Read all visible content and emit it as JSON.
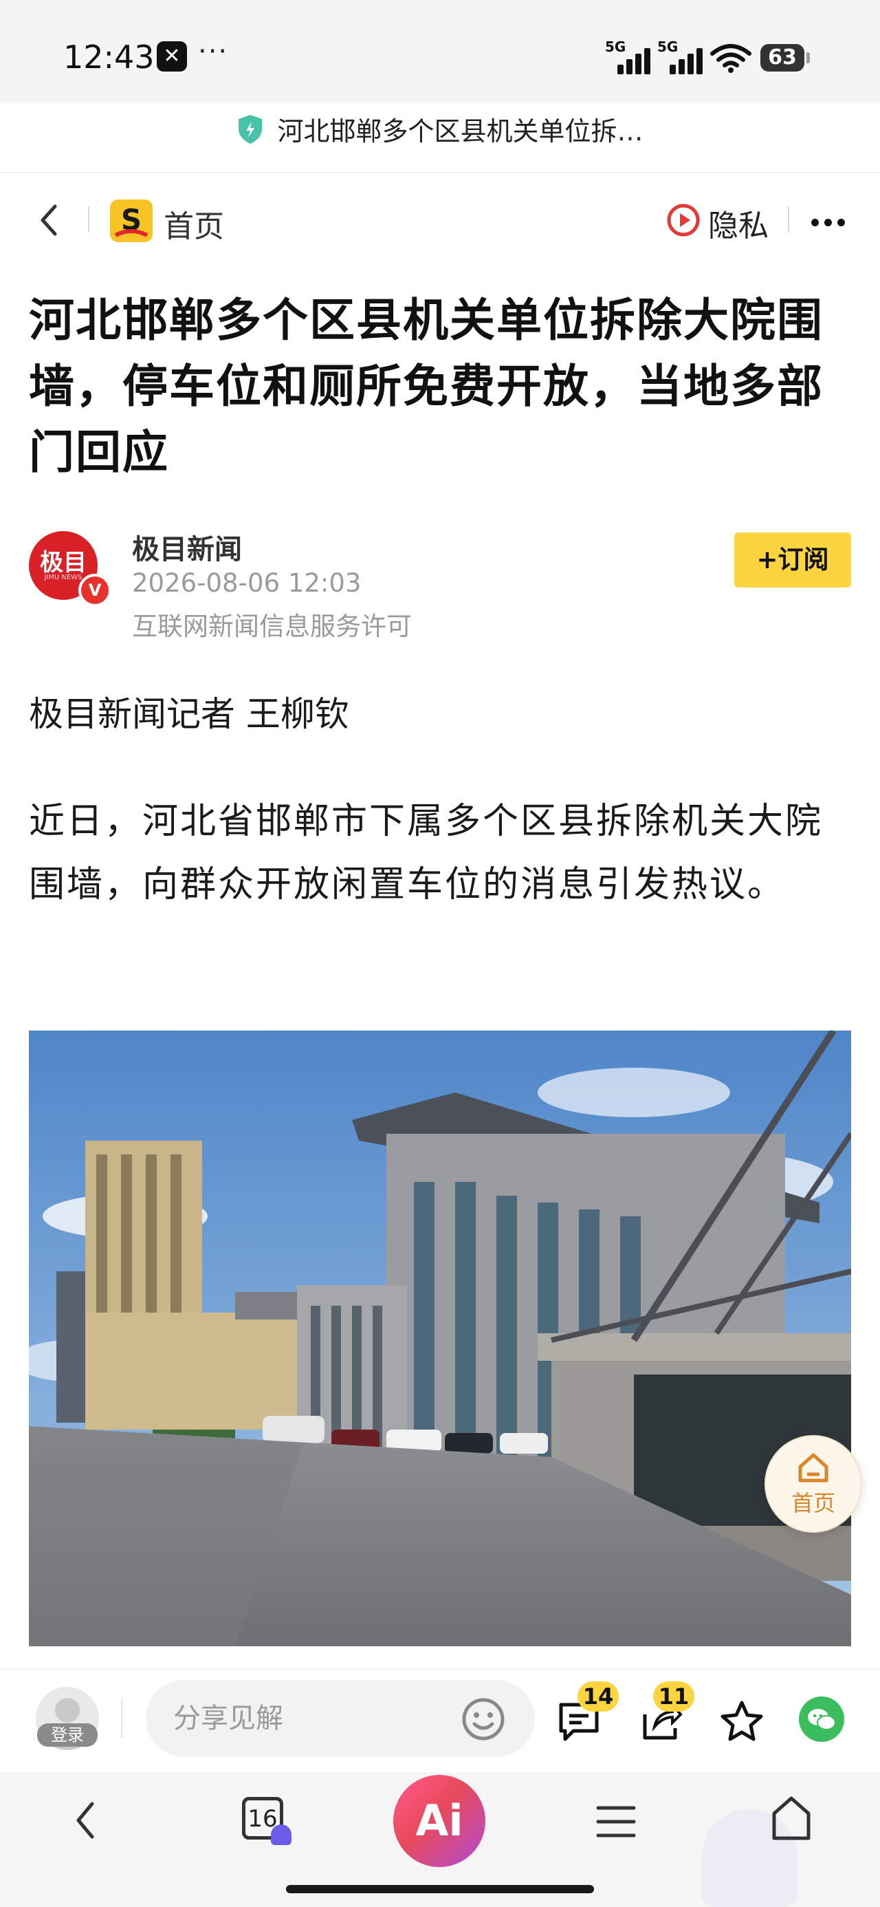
{
  "status_bar": {
    "time": "12:43",
    "network_1": "5G",
    "network_2": "5G",
    "battery": "63",
    "icons": [
      "capcut-icon",
      "more-dots-icon",
      "signal-icon",
      "wifi-icon",
      "battery-icon"
    ]
  },
  "url_bar": {
    "title": "河北邯郸多个区县机关单位拆…",
    "icon": "shield-check-icon"
  },
  "nav": {
    "home_label": "首页",
    "privacy_label": "隐私",
    "icons": [
      "back-icon",
      "sohu-logo-icon",
      "privacy-icon",
      "more-icon"
    ]
  },
  "article": {
    "headline": "河北邯郸多个区县机关单位拆除大院围墙，停车位和厕所免费开放，当地多部门回应",
    "author": {
      "avatar_text": "极目",
      "avatar_subtext": "JIMU NEWS",
      "verified_mark": "V",
      "name": "极目新闻",
      "published": "2026-08-06 12:03",
      "license": "互联网新闻信息服务许可",
      "subscribe_label": "+订阅"
    },
    "reporter_line": "极目新闻记者 王柳钦",
    "paragraph_1": "近日，河北省邯郸市下属多个区县拆除机关大院围墙，向群众开放闲置车位的消息引发热议。",
    "image_description": "government-building-courtyard-photo"
  },
  "float_home": {
    "label": "首页",
    "icon": "house-icon"
  },
  "comment_bar": {
    "login_label": "登录",
    "input_placeholder": "分享见解",
    "comment_count": "14",
    "share_count": "11",
    "icons": [
      "emoji-icon",
      "comments-icon",
      "share-icon",
      "star-icon",
      "wechat-icon"
    ]
  },
  "browser_nav": {
    "tab_count": "16",
    "ai_label": "Ai",
    "icons": [
      "nav-back-icon",
      "tabs-icon",
      "ai-icon",
      "menu-icon",
      "home-icon"
    ]
  },
  "colors": {
    "accent_yellow": "#fbd53f",
    "brand_red": "#d92026",
    "float_home_text": "#d8872c",
    "wechat_green": "#3bbd5d"
  }
}
